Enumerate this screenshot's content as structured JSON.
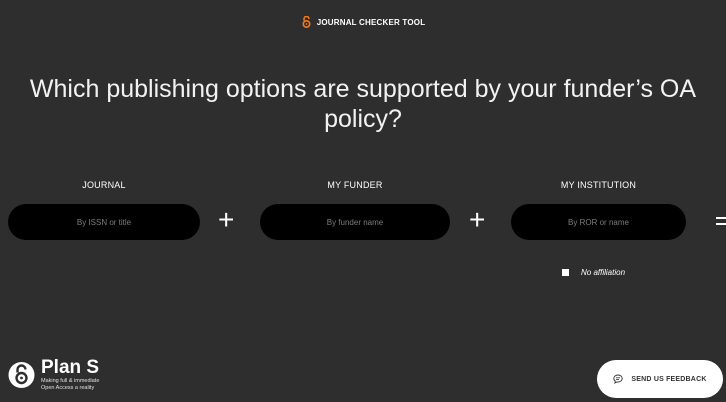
{
  "header": {
    "tool_name": "JOURNAL CHECKER TOOL",
    "logo_icon": "open-access-lock-icon",
    "accent_color": "#f47b20"
  },
  "question": "Which publishing options are supported by your funder’s OA policy?",
  "fields": {
    "journal": {
      "label": "JOURNAL",
      "placeholder": "By ISSN or title"
    },
    "funder": {
      "label": "MY FUNDER",
      "placeholder": "By funder name"
    },
    "institution": {
      "label": "MY INSTITUTION",
      "placeholder": "By ROR or name"
    }
  },
  "operators": {
    "plus": "+"
  },
  "no_affiliation": {
    "label": "No affiliation",
    "checked": false
  },
  "footer": {
    "logo_name": "Plan S",
    "tagline_line1": "Making full & immediate",
    "tagline_line2": "Open Access a reality",
    "feedback_label": "SEND US FEEDBACK",
    "feedback_icon": "speech-bubble-icon"
  },
  "colors": {
    "background": "#2e2e2e",
    "input": "#000000",
    "text": "#ffffff"
  }
}
